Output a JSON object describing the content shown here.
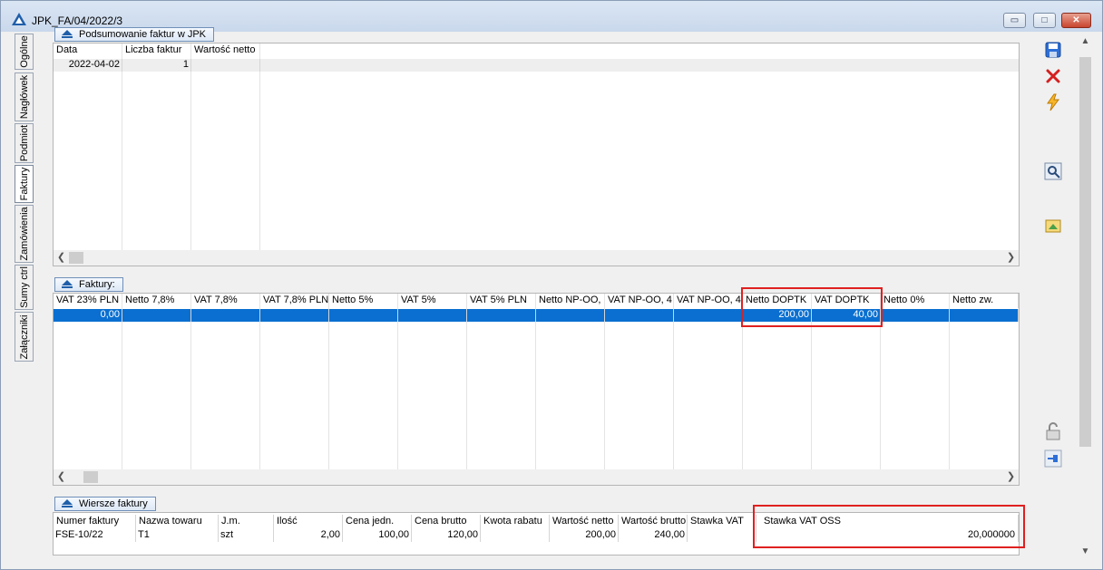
{
  "window": {
    "title": "JPK_FA/04/2022/3",
    "min_icon": "minimize-icon",
    "max_icon": "maximize-icon",
    "close_icon": "close-icon",
    "min_glyph": "▭",
    "max_glyph": "□",
    "close_glyph": "✕"
  },
  "tabs": [
    {
      "label": "Ogólne"
    },
    {
      "label": "Nagłówek"
    },
    {
      "label": "Podmiot"
    },
    {
      "label": "Faktury"
    },
    {
      "label": "Zamówienia"
    },
    {
      "label": "Sumy ctrl"
    },
    {
      "label": "Załączniki"
    }
  ],
  "summary": {
    "title": "Podsumowanie faktur w JPK",
    "columns": [
      "Data",
      "Liczba faktur",
      "Wartość netto"
    ],
    "row": {
      "data": "2022-04-02",
      "liczba": "1",
      "wartosc": ""
    }
  },
  "invoices": {
    "title": "Faktury:",
    "columns": [
      "VAT 23% PLN",
      "Netto 7,8%",
      "VAT 7,8%",
      "VAT 7,8% PLN",
      "Netto 5%",
      "VAT 5%",
      "VAT 5% PLN",
      "Netto NP-OO,",
      "VAT  NP-OO, 4",
      "VAT  NP-OO, 4",
      "Netto DOPTK",
      "VAT DOPTK",
      "Netto 0%",
      "Netto zw."
    ],
    "row": {
      "vat23": "0,00",
      "netto_doptk": "200,00",
      "vat_doptk": "40,00"
    }
  },
  "lines": {
    "title": "Wiersze faktury",
    "columns": [
      "Numer faktury",
      "Nazwa towaru",
      "J.m.",
      "Ilość",
      "Cena jedn.",
      "Cena brutto",
      "Kwota rabatu",
      "Wartość netto",
      "Wartość brutto",
      "Stawka VAT",
      "Stawka VAT OSS"
    ],
    "row": {
      "numer": "FSE-10/22",
      "nazwa": "T1",
      "jm": "szt",
      "ilosc": "2,00",
      "cena_jedn": "100,00",
      "cena_brutto": "120,00",
      "kwota_rabatu": "",
      "wartosc_netto": "200,00",
      "wartosc_brutto": "240,00",
      "stawka_vat": "",
      "stawka_oss": "20,000000"
    }
  },
  "toolbar": {
    "save_icon": "save-icon",
    "delete_icon": "delete-icon",
    "generate_icon": "lightning-icon",
    "preview_icon": "preview-icon",
    "export_icon": "export-icon",
    "lock_icon": "lock-icon",
    "pin_icon": "pin-icon"
  },
  "colors": {
    "selection": "#0a6fd0",
    "highlight": "#e02020",
    "accent": "#1f5faa"
  }
}
